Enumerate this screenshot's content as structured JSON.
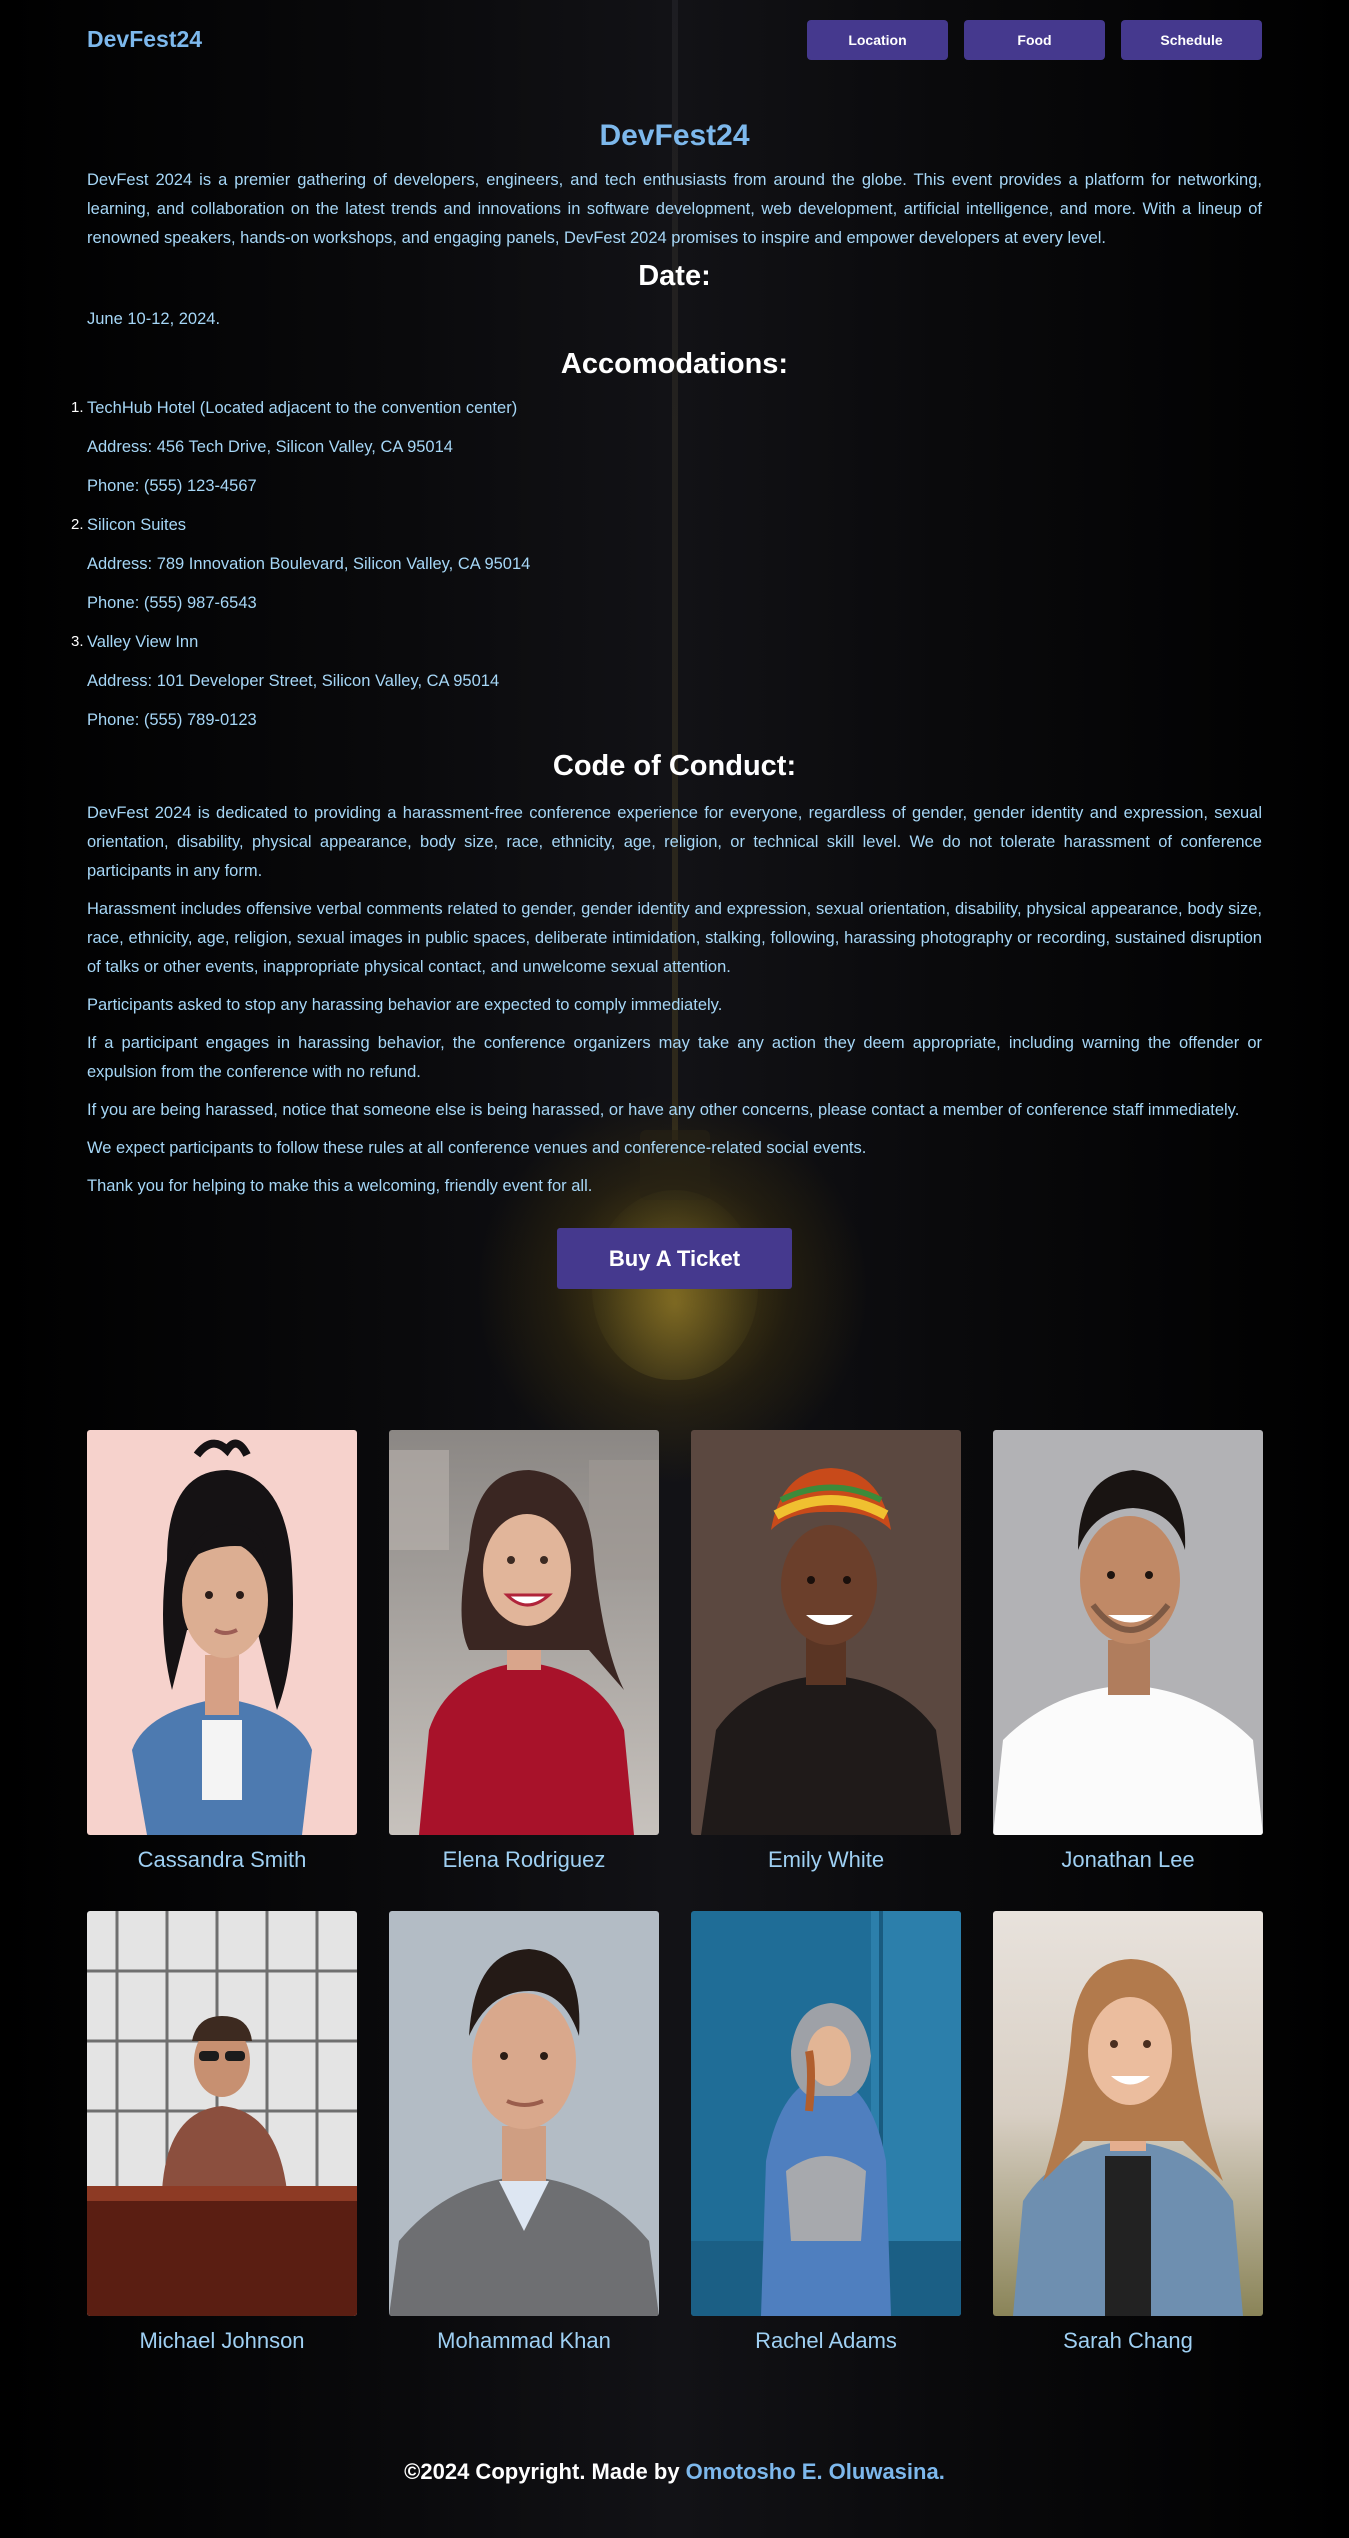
{
  "header": {
    "logo": "DevFest24",
    "nav": [
      "Location",
      "Food",
      "Schedule"
    ]
  },
  "main": {
    "title": "DevFest24",
    "intro": "DevFest 2024 is a premier gathering of developers, engineers, and tech enthusiasts from around the globe. This event provides a platform for networking, learning, and collaboration on the latest trends and innovations in software development, web development, artificial intelligence, and more. With a lineup of renowned speakers, hands-on workshops, and engaging panels, DevFest 2024 promises to inspire and empower developers at every level.",
    "date_heading": "Date:",
    "date": "June 10-12, 2024.",
    "accommodations_heading": "Accomodations:",
    "hotels": [
      {
        "num": "1.",
        "name": "TechHub Hotel (Located adjacent to the convention center)",
        "address": "Address: 456 Tech Drive, Silicon Valley, CA 95014",
        "phone": "Phone: (555) 123-4567"
      },
      {
        "num": "2.",
        "name": "Silicon Suites",
        "address": "Address: 789 Innovation Boulevard, Silicon Valley, CA 95014",
        "phone": "Phone: (555) 987-6543"
      },
      {
        "num": "3.",
        "name": "Valley View Inn",
        "address": "Address: 101 Developer Street, Silicon Valley, CA 95014",
        "phone": "Phone: (555) 789-0123"
      }
    ],
    "conduct_heading": "Code of Conduct:",
    "conduct": [
      "DevFest 2024 is dedicated to providing a harassment-free conference experience for everyone, regardless of gender, gender identity and expression, sexual orientation, disability, physical appearance, body size, race, ethnicity, age, religion, or technical skill level. We do not tolerate harassment of conference participants in any form.",
      "Harassment includes offensive verbal comments related to gender, gender identity and expression, sexual orientation, disability, physical appearance, body size, race, ethnicity, age, religion, sexual images in public spaces, deliberate intimidation, stalking, following, harassing photography or recording, sustained disruption of talks or other events, inappropriate physical contact, and unwelcome sexual attention.",
      "Participants asked to stop any harassing behavior are expected to comply immediately.",
      "If a participant engages in harassing behavior, the conference organizers may take any action they deem appropriate, including warning the offender or expulsion from the conference with no refund.",
      "If you are being harassed, notice that someone else is being harassed, or have any other concerns, please contact a member of conference staff immediately.",
      "We expect participants to follow these rules at all conference venues and conference-related social events.",
      "Thank you for helping to make this a welcoming, friendly event for all."
    ],
    "ticket_button": "Buy A Ticket"
  },
  "speakers": [
    {
      "name": "Cassandra Smith"
    },
    {
      "name": "Elena Rodriguez"
    },
    {
      "name": "Emily White"
    },
    {
      "name": "Jonathan Lee"
    },
    {
      "name": "Michael Johnson"
    },
    {
      "name": "Mohammad Khan"
    },
    {
      "name": "Rachel Adams"
    },
    {
      "name": "Sarah Chang"
    }
  ],
  "footer": {
    "text": "©2024 Copyright. Made by ",
    "author": "Omotosho E. Oluwasina."
  },
  "colors": {
    "accent": "#45398e",
    "link": "#7db8ec",
    "text": "#a6d7f7",
    "background": "#000000"
  }
}
